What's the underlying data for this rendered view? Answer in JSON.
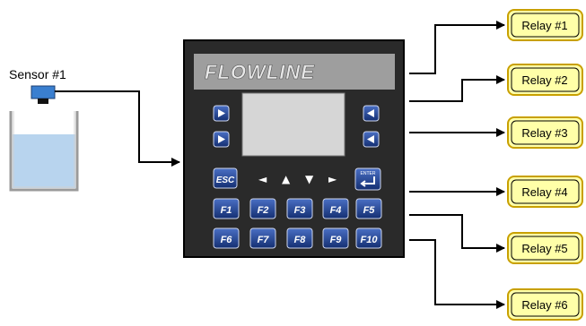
{
  "sensor": {
    "label": "Sensor #1"
  },
  "controller": {
    "brand": "FLOWLINE",
    "esc_label": "ESC",
    "enter_label": "ENTER",
    "function_keys_row1": [
      "F1",
      "F2",
      "F3",
      "F4",
      "F5"
    ],
    "function_keys_row2": [
      "F6",
      "F7",
      "F8",
      "F9",
      "F10"
    ]
  },
  "relays": [
    "Relay #1",
    "Relay #2",
    "Relay #3",
    "Relay #4",
    "Relay #5",
    "Relay #6"
  ],
  "colors": {
    "relay_fill": "#ffffa8",
    "relay_border": "#c8a000",
    "controller_body": "#2a2a2a",
    "brand_band": "#9e9e9e",
    "screen": "#d6d6d6",
    "key_blue": "#1f3f8f",
    "water": "#b8d4ee",
    "sensor_blue": "#3a7fd0"
  }
}
